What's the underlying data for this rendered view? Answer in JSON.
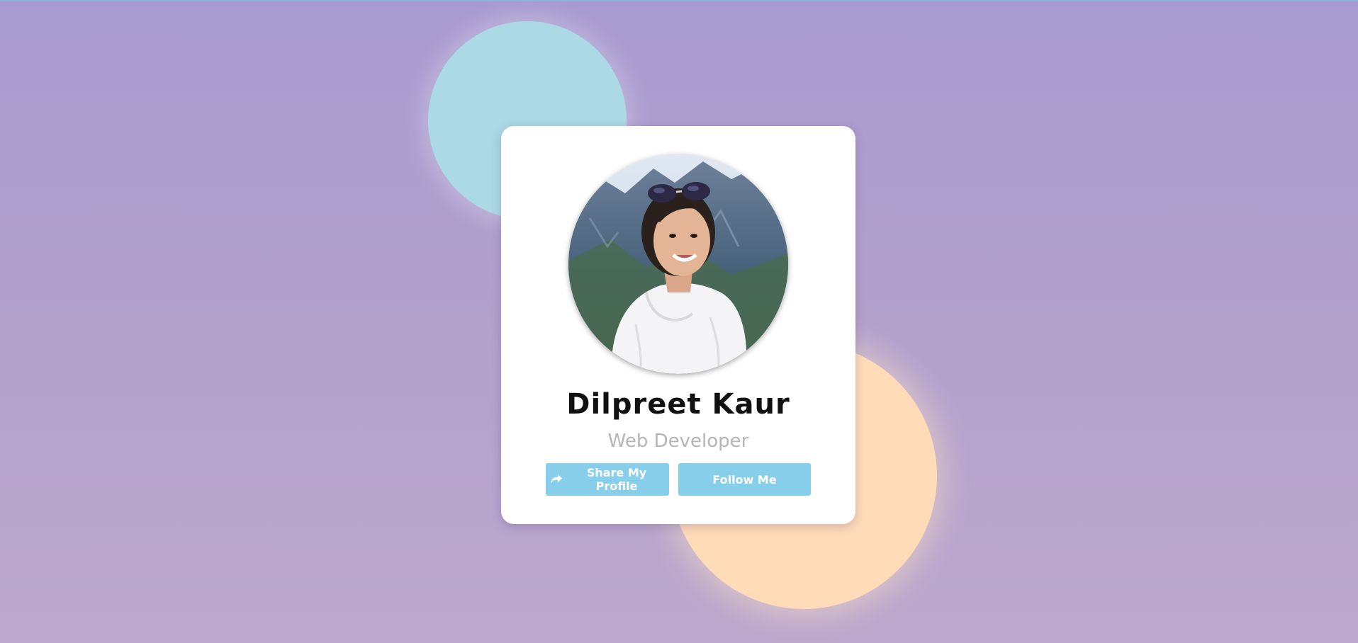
{
  "profile": {
    "name": "Dilpreet Kaur",
    "role": "Web Developer"
  },
  "actions": {
    "share_label": "Share My Profile",
    "follow_label": "Follow Me"
  },
  "icons": {
    "share": "share-icon"
  },
  "colors": {
    "background": "#ac9fd0",
    "button": "#87ceeb",
    "blob_blue": "#abd9e5",
    "blob_peach": "#ffdbb8",
    "role_text": "#b5b5b5"
  }
}
